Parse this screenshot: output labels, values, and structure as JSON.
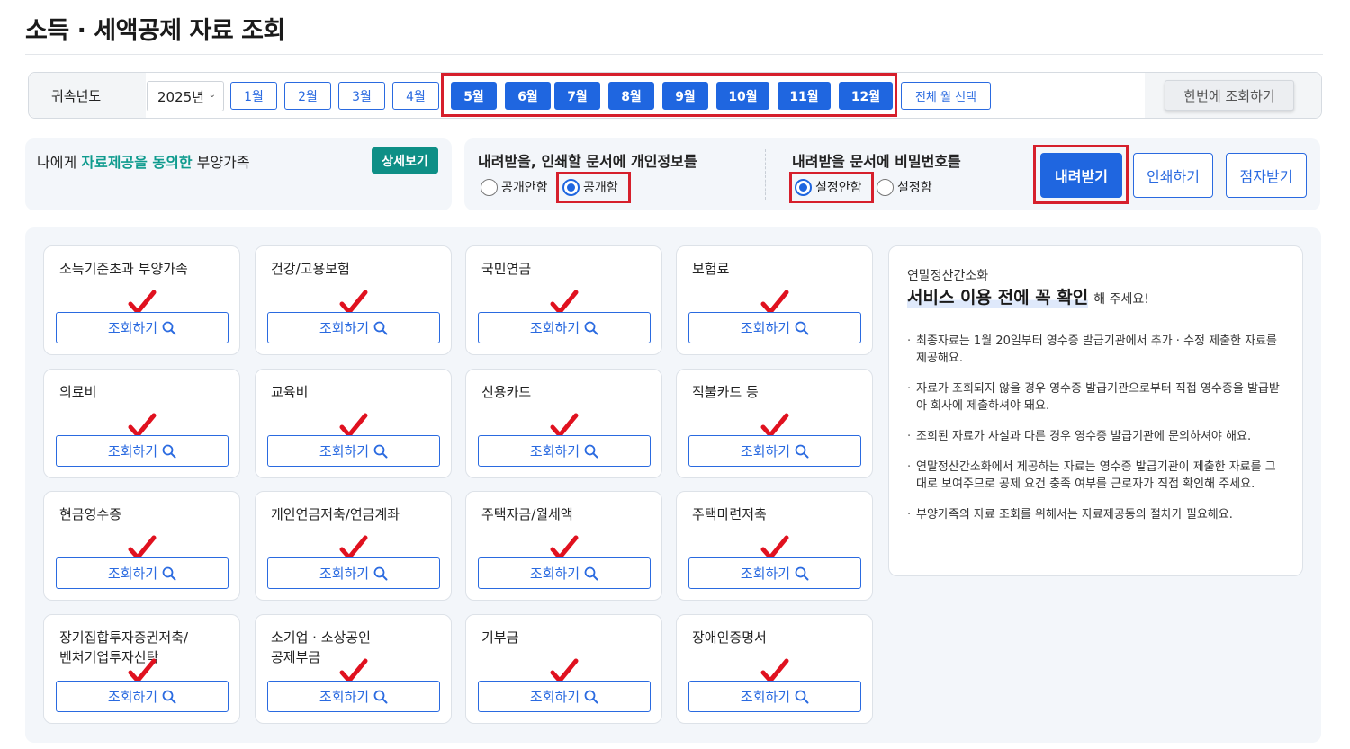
{
  "page": {
    "title": "소득 · 세액공제 자료 조회"
  },
  "toolbar": {
    "label": "귀속년도",
    "year": "2025년",
    "months": [
      {
        "label": "1월",
        "selected": false
      },
      {
        "label": "2월",
        "selected": false
      },
      {
        "label": "3월",
        "selected": false
      },
      {
        "label": "4월",
        "selected": false
      },
      {
        "label": "5월",
        "selected": true
      },
      {
        "label": "6월",
        "selected": true
      },
      {
        "label": "7월",
        "selected": true
      },
      {
        "label": "8월",
        "selected": true
      },
      {
        "label": "9월",
        "selected": true
      },
      {
        "label": "10월",
        "selected": true
      },
      {
        "label": "11월",
        "selected": true
      },
      {
        "label": "12월",
        "selected": true
      }
    ],
    "select_all": "전체 월 선택",
    "query_all": "한번에 조회하기"
  },
  "consent": {
    "prefix": "나에게 ",
    "highlight": "자료제공을 동의한",
    "suffix": " 부양가족",
    "detail_button": "상세보기"
  },
  "privacy": {
    "heading": "내려받을, 인쇄할 문서에 개인정보를",
    "options": [
      {
        "label": "공개안함",
        "selected": false
      },
      {
        "label": "공개함",
        "selected": true
      }
    ]
  },
  "password": {
    "heading": "내려받을 문서에 비밀번호를",
    "options": [
      {
        "label": "설정안함",
        "selected": true
      },
      {
        "label": "설정함",
        "selected": false
      }
    ]
  },
  "actions": {
    "download": "내려받기",
    "print": "인쇄하기",
    "braille": "점자받기"
  },
  "cards": [
    {
      "title": "소득기준초과 부양가족",
      "button": "조회하기"
    },
    {
      "title": "건강/고용보험",
      "button": "조회하기"
    },
    {
      "title": "국민연금",
      "button": "조회하기"
    },
    {
      "title": "보험료",
      "button": "조회하기"
    },
    {
      "title": "의료비",
      "button": "조회하기"
    },
    {
      "title": "교육비",
      "button": "조회하기"
    },
    {
      "title": "신용카드",
      "button": "조회하기"
    },
    {
      "title": "직불카드 등",
      "button": "조회하기"
    },
    {
      "title": "현금영수증",
      "button": "조회하기"
    },
    {
      "title": "개인연금저축/연금계좌",
      "button": "조회하기"
    },
    {
      "title": "주택자금/월세액",
      "button": "조회하기"
    },
    {
      "title": "주택마련저축",
      "button": "조회하기"
    },
    {
      "title": "장기집합투자증권저축/\n벤처기업투자신탁",
      "button": "조회하기"
    },
    {
      "title": "소기업 · 소상공인\n공제부금",
      "button": "조회하기"
    },
    {
      "title": "기부금",
      "button": "조회하기"
    },
    {
      "title": "장애인증명서",
      "button": "조회하기"
    }
  ],
  "info": {
    "small_title": "연말정산간소화",
    "main_title": "서비스 이용 전에 꼭 확인",
    "main_suffix": "해 주세요!",
    "bullets": [
      "최종자료는 1월 20일부터 영수증 발급기관에서 추가 · 수정 제출한 자료를 제공해요.",
      "자료가 조회되지 않을 경우 영수증 발급기관으로부터 직접 영수증을 발급받아 회사에 제출하셔야 돼요.",
      "조회된 자료가 사실과 다른 경우 영수증 발급기관에 문의하셔야 해요.",
      "연말정산간소화에서 제공하는 자료는 영수증 발급기관이 제출한 자료를 그대로 보여주므로 공제 요건 충족 여부를 근로자가 직접 확인해 주세요.",
      "부양가족의 자료 조회를 위해서는 자료제공동의 절차가 필요해요."
    ]
  },
  "colors": {
    "primary": "#1f66e0",
    "teal": "#0e8f86",
    "annotation_red": "#d61f2c"
  }
}
